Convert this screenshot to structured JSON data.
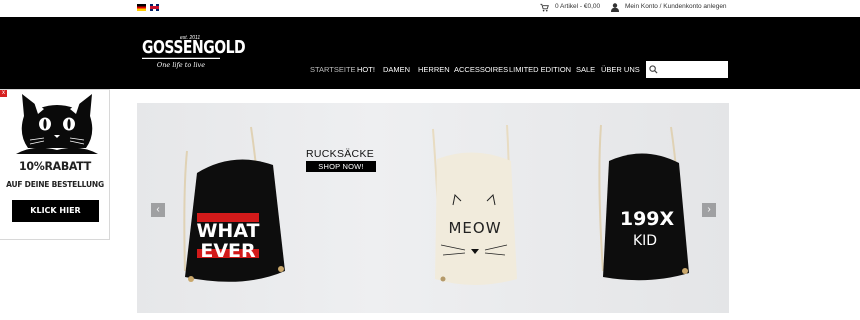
{
  "topbar": {
    "languages": [
      "DE",
      "EN"
    ],
    "cart_text": "0 Artikel - €0,00",
    "account_text": "Mein Konto / Kundenkonto anlegen"
  },
  "brand": {
    "est": "est. 2011",
    "name": "GOSSENGOLD",
    "tagline": "One life to live"
  },
  "nav": {
    "items": [
      "STARTSEITE",
      "HOT!",
      "DAMEN",
      "HERREN",
      "ACCESSOIRES",
      "LIMITED EDITION",
      "SALE",
      "ÜBER UNS"
    ],
    "active_index": 0
  },
  "search": {
    "value": "",
    "placeholder": ""
  },
  "promo": {
    "close_label": "x",
    "discount": "10%RABATT",
    "subtitle": "AUF DEINE BESTELLUNG",
    "button_label": "KLICK HIER"
  },
  "slider": {
    "title": "RUCKSÄCKE",
    "cta_label": "SHOP NOW!",
    "prev_label": "‹",
    "next_label": "›",
    "products": [
      {
        "print_line1": "WHAT",
        "print_line2": "EVER",
        "color": "#0d0d0d"
      },
      {
        "print_line1": "MEOW",
        "print_line2": "",
        "color": "#f1ebdc"
      },
      {
        "print_line1": "199X",
        "print_line2": "KID",
        "color": "#0d0d0d"
      }
    ]
  },
  "colors": {
    "navbar_bg": "#000000",
    "accent_red": "#d62020",
    "slider_bg": "#e9eaec"
  }
}
